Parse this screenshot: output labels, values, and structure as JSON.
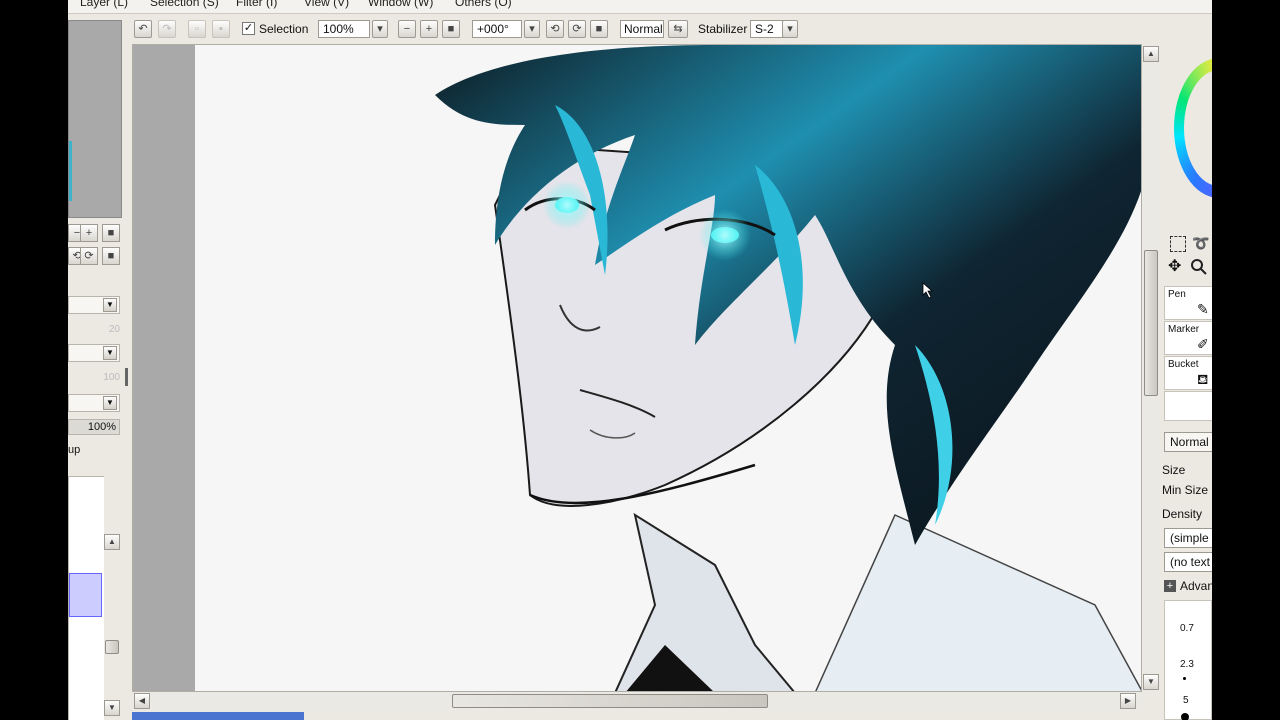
{
  "menu": [
    "Layer (L)",
    "Selection (S)",
    "Filter (I)",
    "View (V)",
    "Window (W)",
    "Others (O)"
  ],
  "toolbar": {
    "selection_label": "Selection",
    "selection_checked": true,
    "zoom_value": "100%",
    "rotation_value": "+000°",
    "blend_mode": "Normal",
    "stabilizer_label": "Stabilizer",
    "stabilizer_value": "S-2"
  },
  "left_panel": {
    "value_20": "20",
    "value_100": "100",
    "opacity_value": "100%",
    "group_label_partial": "up"
  },
  "right_panel": {
    "tools": [
      {
        "label": "Pen",
        "icon": "pen-icon"
      },
      {
        "label": "Marker",
        "icon": "marker-icon"
      },
      {
        "label": "Bucket",
        "icon": "bucket-icon"
      }
    ],
    "blend_mode": "Normal",
    "size_label": "Size",
    "min_size_label": "Min Size",
    "density_label": "Density",
    "shape_option": "(simple c",
    "texture_option": "(no text",
    "advanced_label": "Advan",
    "brush_sizes": [
      "0.7",
      "2.3",
      "5"
    ]
  },
  "colors": {
    "hair_accent": "#29b8d6",
    "eye_glow": "#39f2f0",
    "selection_fill": "#ccccff",
    "canvas_bg": "#f6f6f6",
    "panel_bg": "#ece9e2"
  }
}
